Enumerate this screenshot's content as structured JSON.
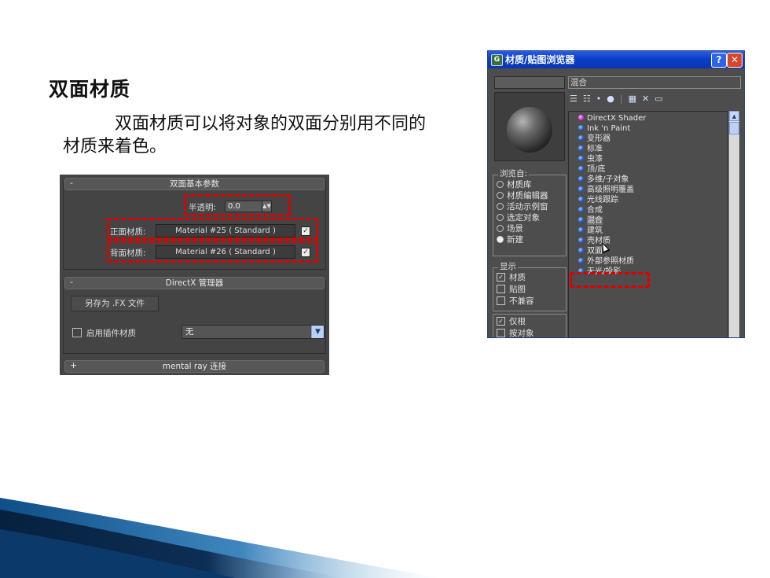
{
  "slide": {
    "title": "双面材质",
    "body": "双面材质可以将对象的双面分别用不同的材质来着色。"
  },
  "params_panel": {
    "rollout1": {
      "sign": "-",
      "title": "双面基本参数"
    },
    "translucency": {
      "label": "半透明:",
      "value": "0.0"
    },
    "facing_material": {
      "label": "正面材质:",
      "button": "Material #25 ( Standard )",
      "checked": true
    },
    "back_material": {
      "label": "背面材质:",
      "button": "Material #26 ( Standard )",
      "checked": true
    },
    "rollout2": {
      "sign": "-",
      "title": "DirectX 管理器"
    },
    "save_fx_button": "另存为 .FX 文件",
    "enable_plugin": {
      "label": "启用插件材质",
      "checked": false
    },
    "plugin_dropdown": {
      "value": "无"
    },
    "rollout3": {
      "sign": "+",
      "title": "mental ray 连接"
    }
  },
  "browser": {
    "title": "材质/贴图浏览器",
    "help": "?",
    "close": "✕",
    "name_field": "混合",
    "toolbar_icons": [
      "list-icon",
      "list-icons-icon",
      "small-icons-icon",
      "large-icons-icon",
      "swatch-icon",
      "delete-icon",
      "clear-icon"
    ],
    "browse_from": {
      "title": "浏览自:",
      "options": [
        "材质库",
        "材质编辑器",
        "活动示例窗",
        "选定对象",
        "场景",
        "新建"
      ],
      "selected": "新建"
    },
    "show": {
      "title": "显示",
      "options": [
        {
          "label": "材质",
          "checked": true
        },
        {
          "label": "贴图",
          "checked": false
        },
        {
          "label": "不兼容",
          "checked": false
        }
      ]
    },
    "filter": {
      "options": [
        {
          "label": "仅根",
          "checked": true
        },
        {
          "label": "按对象",
          "checked": false
        }
      ]
    },
    "list": [
      {
        "label": "DirectX Shader",
        "color": "pink"
      },
      {
        "label": "Ink 'n Paint",
        "color": "blue"
      },
      {
        "label": "变形器",
        "color": "blue"
      },
      {
        "label": "标准",
        "color": "blue"
      },
      {
        "label": "虫漆",
        "color": "blue"
      },
      {
        "label": "顶/底",
        "color": "blue"
      },
      {
        "label": "多维/子对象",
        "color": "blue"
      },
      {
        "label": "高级照明覆盖",
        "color": "blue"
      },
      {
        "label": "光线跟踪",
        "color": "blue"
      },
      {
        "label": "合成",
        "color": "blue"
      },
      {
        "label": "混合",
        "color": "blue"
      },
      {
        "label": "建筑",
        "color": "blue"
      },
      {
        "label": "壳材质",
        "color": "blue"
      },
      {
        "label": "双面",
        "color": "blue"
      },
      {
        "label": "外部参照材质",
        "color": "blue"
      },
      {
        "label": "无光/投影",
        "color": "blue"
      }
    ]
  }
}
